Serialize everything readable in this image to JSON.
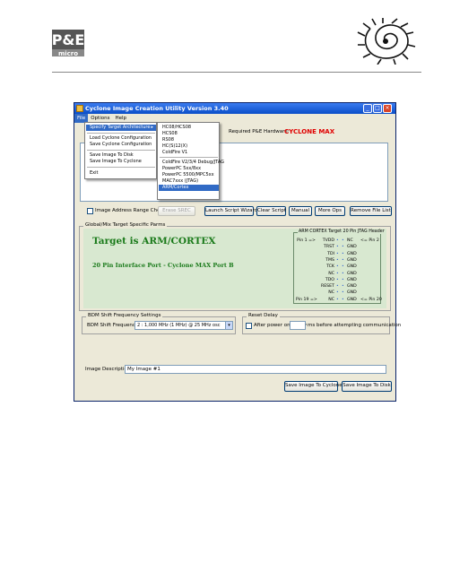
{
  "header": {
    "pe_logo_top": "P&E",
    "pe_logo_bottom": "micro"
  },
  "window": {
    "title": "Cyclone Image Creation Utility Version 3.40",
    "menu": [
      "File",
      "Options",
      "Help"
    ],
    "required_label": "Required P&E Hardware:",
    "required_value": "CYCLONE MAX"
  },
  "file_menu": {
    "items": [
      "Specify Target Architecture",
      "Load Cyclone Configuration",
      "Save Cyclone Configuration",
      "Save Image To Disk",
      "Save Image To Cyclone",
      "Exit"
    ],
    "arrow": "▸"
  },
  "arch_submenu": {
    "items": [
      "HC08/HCS08",
      "HCS08",
      "RS08",
      "HC(S)12(X)",
      "ColdFire V1",
      "ColdFire V2/3/4 Debug/JTAG",
      "PowerPC 5xx/8xx",
      "PowerPC 5500/MPC5xx",
      "MAC7xxx (JTAG)",
      "ARM/Cortex"
    ],
    "highlighted_index": 9
  },
  "buttons": {
    "image_address": "Image Address Range Check",
    "erase_btn": "Erase SREC",
    "launch_script": "Launch Script Wizard",
    "clear_script": "Clear Script",
    "manual": "Manual",
    "more_ops": "More Ops",
    "remove_file": "Remove File List",
    "save_to_cyclone": "Save Image To Cyclone",
    "save_to_disk": "Save Image To Disk"
  },
  "target_panel": {
    "group_label": "Global/Mix Target Specific Parms",
    "title": "Target is ARM/CORTEX",
    "port": "20 Pin Interface Port - Cyclone MAX Port B",
    "pin_header": "ARM CORTEX Target 20 Pin JTAG Header",
    "pins": [
      {
        "left": "Pin 1 =>",
        "sig": "TVDD",
        "right": "NC",
        "note": "<= Pin 2"
      },
      {
        "left": "",
        "sig": "TRST",
        "right": "GND",
        "note": ""
      },
      {
        "left": "",
        "sig": "TDI",
        "right": "GND",
        "note": ""
      },
      {
        "left": "",
        "sig": "TMS",
        "right": "GND",
        "note": ""
      },
      {
        "left": "",
        "sig": "TCK",
        "right": "GND",
        "note": ""
      },
      {
        "left": "",
        "sig": "NC",
        "right": "GND",
        "note": ""
      },
      {
        "left": "",
        "sig": "TDO",
        "right": "GND",
        "note": ""
      },
      {
        "left": "",
        "sig": "RESET",
        "right": "GND",
        "note": ""
      },
      {
        "left": "",
        "sig": "NC",
        "right": "GND",
        "note": ""
      },
      {
        "left": "Pin 19 =>",
        "sig": "NC",
        "right": "GND",
        "note": "<= Pin 20"
      }
    ],
    "pin_dot": "•"
  },
  "bdm": {
    "group_label": "BDM Shift Frequency Settings",
    "label": "BDM Shift Frequency:",
    "value": "2 : 1,000 MHz (1 MHz) @ 25 MHz osc",
    "arrow": "▾"
  },
  "reset": {
    "group_label": "Reset Delay",
    "opt1": "After power on, delay",
    "opt2": "ms before attempting communication"
  },
  "image_desc": {
    "label": "Image Description:",
    "value": "My Image #1"
  }
}
